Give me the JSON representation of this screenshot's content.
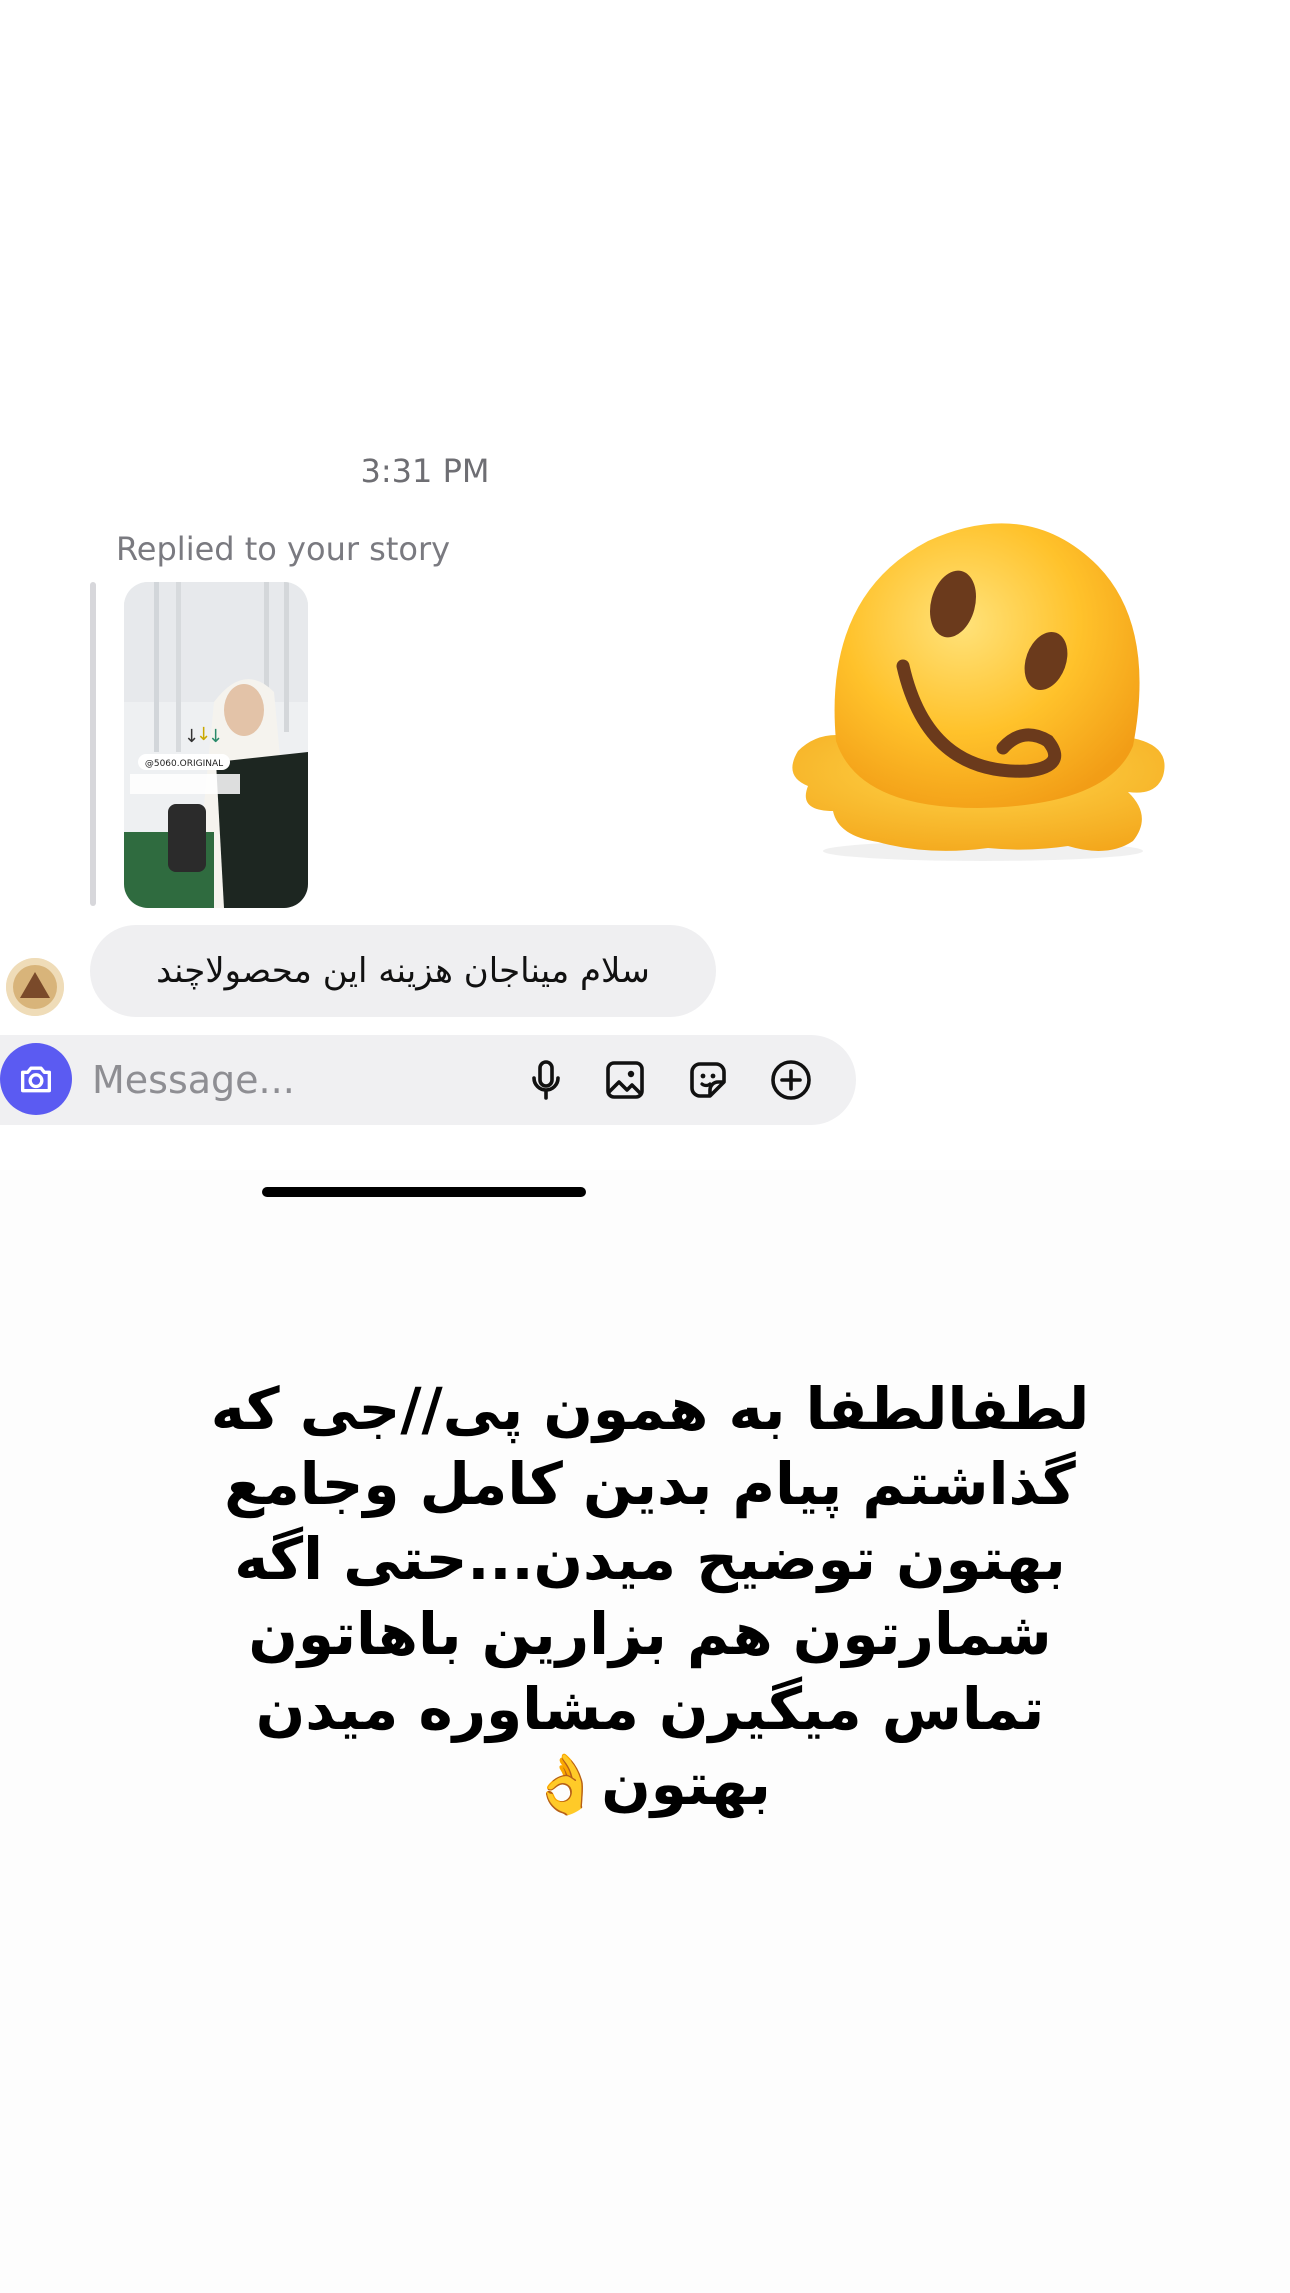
{
  "chat": {
    "timestamp": "3:31 PM",
    "reply_label": "Replied to your story",
    "story": {
      "handle": "@5060.ORIGINAL"
    },
    "message": "سلام میناجان هزینه این محصولاچند"
  },
  "composer": {
    "placeholder": "Message...",
    "icons": [
      "camera-icon",
      "microphone-icon",
      "gallery-icon",
      "sticker-icon",
      "plus-icon"
    ]
  },
  "story_overlay": {
    "sticker": "melting-face-emoji",
    "caption": "لطفالطفا به همون پی//جی که گذاشتم پیام بدین کامل وجامع بهتون توضیح میدن...حتی اگه شمارتون هم بزارین باهاتون تماس میگیرن مشاوره میدن بهتون👌"
  },
  "colors": {
    "accent": "#5b5bf2",
    "bubble": "#efeff1",
    "background": "#fdfdfd"
  }
}
